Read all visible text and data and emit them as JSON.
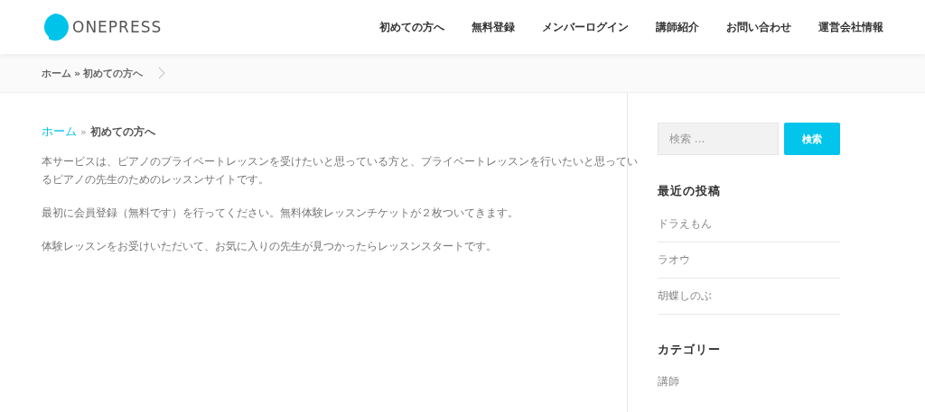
{
  "header": {
    "logo_text": "ONEPRESS",
    "nav": [
      "初めての方へ",
      "無料登録",
      "メンバーログイン",
      "講師紹介",
      "お問い合わせ",
      "運営会社情報"
    ]
  },
  "title_bar": {
    "breadcrumb": [
      "ホーム",
      "»",
      "初めての方へ"
    ]
  },
  "content": {
    "breadcrumb": {
      "link": "ホーム",
      "separator": "»",
      "current": "初めての方へ"
    },
    "paragraphs": [
      "本サービスは、ピアノのプライベートレッスンを受けたいと思っている方と、プライベートレッスンを行いたいと思っているピアノの先生のためのレッスンサイトです。",
      "最初に会員登録（無料です）を行ってください。無料体験レッスンチケットが２枚ついてきます。",
      "体験レッスンをお受けいただいて、お気に入りの先生が見つかったらレッスンスタートです。"
    ]
  },
  "sidebar": {
    "search": {
      "placeholder": "検索 ...",
      "button": "検索"
    },
    "recent_posts": {
      "title": "最近の投稿",
      "items": [
        "ドラえもん",
        "ラオウ",
        "胡蝶しのぶ"
      ]
    },
    "categories": {
      "title": "カテゴリー",
      "items": [
        "講師"
      ]
    }
  }
}
